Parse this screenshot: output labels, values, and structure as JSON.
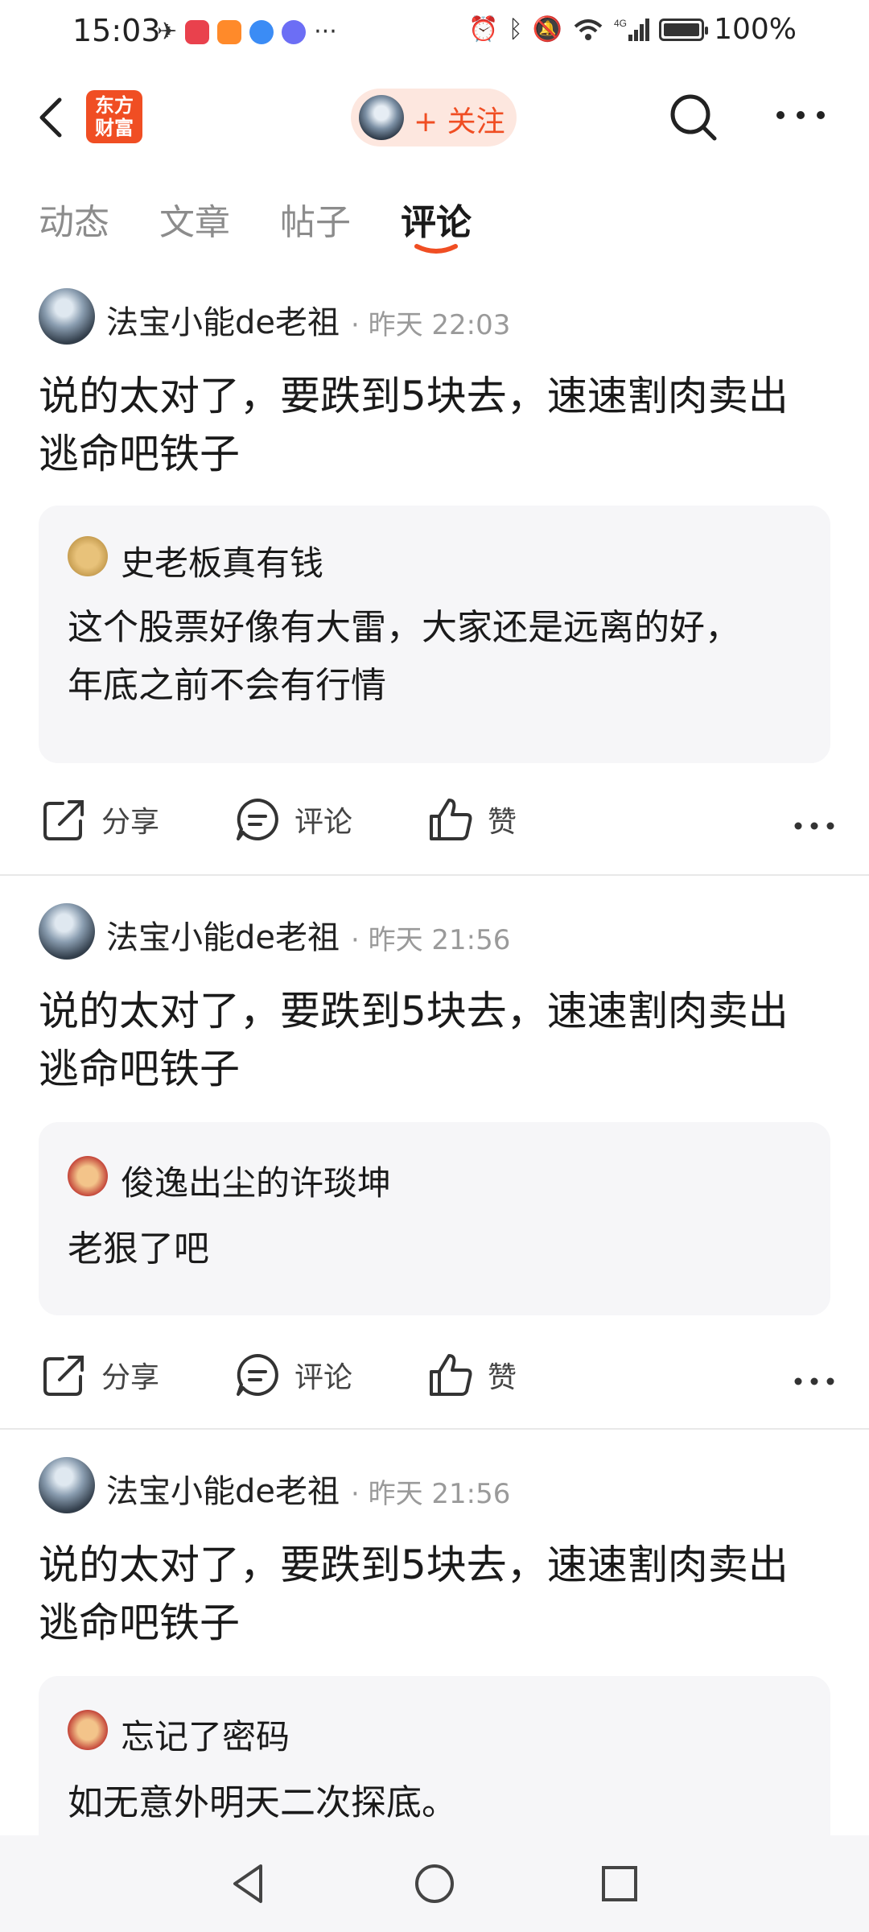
{
  "status_bar": {
    "time": "15:03",
    "battery_text": "100%",
    "battery_level": 1.0,
    "network": "4G",
    "icons": [
      "notification-icon",
      "app-red-icon",
      "app-orange-icon",
      "app-blue-icon",
      "app-music-icon",
      "more-dots-icon",
      "alarm-icon",
      "bluetooth-icon",
      "mute-icon",
      "wifi-icon",
      "signal-icon",
      "battery-icon"
    ]
  },
  "header": {
    "logo_line1": "东方",
    "logo_line2": "财富",
    "follow_label": "+ 关注",
    "icons": [
      "back-icon",
      "search-icon",
      "more-icon"
    ]
  },
  "tabs": [
    {
      "label": "动态",
      "active": false
    },
    {
      "label": "文章",
      "active": false
    },
    {
      "label": "帖子",
      "active": false
    },
    {
      "label": "评论",
      "active": true
    }
  ],
  "comments": [
    {
      "user": "法宝小能de老祖",
      "time": "· 昨天 22:03",
      "text_line1": "说的太对了，要跌到5块去，速速割肉卖出",
      "text_line2": "逃命吧铁子",
      "quote": {
        "user": "史老板真有钱",
        "text_line1": "这个股票好像有大雷，大家还是远离的好，",
        "text_line2": "年底之前不会有行情"
      },
      "actions": {
        "share": "分享",
        "comment": "评论",
        "like": "赞"
      }
    },
    {
      "user": "法宝小能de老祖",
      "time": "· 昨天 21:56",
      "text_line1": "说的太对了，要跌到5块去，速速割肉卖出",
      "text_line2": "逃命吧铁子",
      "quote": {
        "user": "俊逸出尘的许琰坤",
        "text_line1": "老狠了吧"
      },
      "actions": {
        "share": "分享",
        "comment": "评论",
        "like": "赞"
      }
    },
    {
      "user": "法宝小能de老祖",
      "time": "· 昨天 21:56",
      "text_line1": "说的太对了，要跌到5块去，速速割肉卖出",
      "text_line2": "逃命吧铁子",
      "quote": {
        "user": "忘记了密码",
        "text_line1": "如无意外明天二次探底。"
      }
    }
  ],
  "colors": {
    "accent": "#f04e23",
    "follow_bg": "#fde7df",
    "quote_bg": "#f6f6f8",
    "muted_text": "#9a9a9a"
  }
}
